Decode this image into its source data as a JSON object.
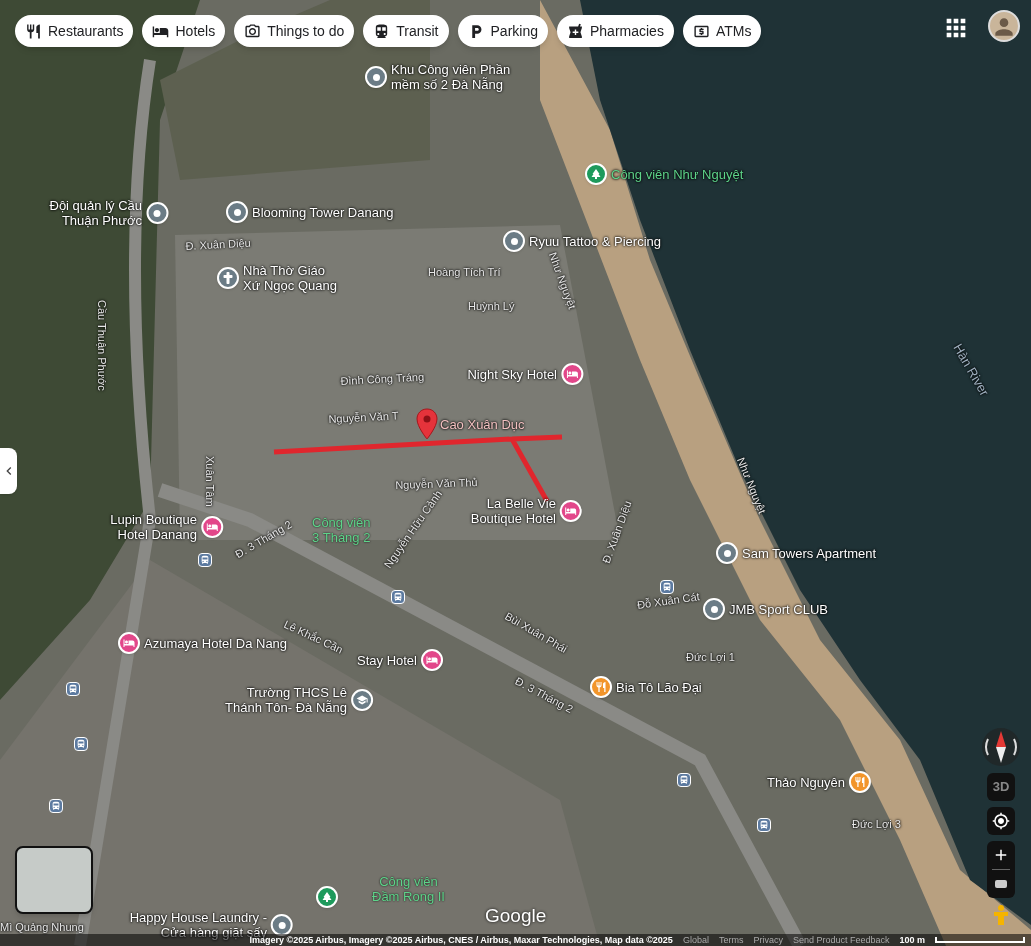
{
  "filter_chips": [
    {
      "label": "Restaurants",
      "kind": "restaurant"
    },
    {
      "label": "Hotels",
      "kind": "hotel"
    },
    {
      "label": "Things to do",
      "kind": "camera"
    },
    {
      "label": "Transit",
      "kind": "transit"
    },
    {
      "label": "Parking",
      "kind": "parking"
    },
    {
      "label": "Pharmacies",
      "kind": "pharmacy"
    },
    {
      "label": "ATMs",
      "kind": "atm"
    }
  ],
  "places": [
    {
      "name": "Khu Công viên Phần\nmềm số 2 Đà Nẵng",
      "kind": "pin",
      "color": "#6b7c86"
    },
    {
      "name": "Công viên Như Nguyệt",
      "kind": "park",
      "color": "#1e9a5c"
    },
    {
      "name": "Đội quản lý Cầu\nThuận Phước",
      "kind": "pin",
      "color": "#6b7c86"
    },
    {
      "name": "Blooming Tower Danang",
      "kind": "pin",
      "color": "#6b7c86"
    },
    {
      "name": "Ryuu Tattoo & Piercing",
      "kind": "pin",
      "color": "#6b7c86"
    },
    {
      "name": "Nhà Thờ Giáo\nXứ Ngọc Quang",
      "kind": "church",
      "color": "#6b7c86"
    },
    {
      "name": "Night Sky Hotel",
      "kind": "hotel",
      "color": "#e2478a"
    },
    {
      "name": "La Belle Vie\nBoutique Hotel",
      "kind": "hotel",
      "color": "#e2478a"
    },
    {
      "name": "Lupin Boutique\nHotel Danang",
      "kind": "hotel",
      "color": "#e2478a"
    },
    {
      "name": "Sam Towers Apartment",
      "kind": "pin",
      "color": "#6b7c86"
    },
    {
      "name": "JMB Sport CLUB",
      "kind": "pin",
      "color": "#6b7c86"
    },
    {
      "name": "Azumaya Hotel Da Nang",
      "kind": "hotel",
      "color": "#e2478a"
    },
    {
      "name": "Stay Hotel",
      "kind": "hotel",
      "color": "#e2478a"
    },
    {
      "name": "Bia Tô Lão Đại",
      "kind": "restaurant",
      "color": "#f2952b"
    },
    {
      "name": "Trường THCS Lê\nThánh Tôn- Đà Nẵng",
      "kind": "school",
      "color": "#6b7c86"
    },
    {
      "name": "Thảo Nguyên",
      "kind": "restaurant",
      "color": "#f2952b"
    },
    {
      "name": "Happy House Laundry -\nCửa hàng giặt sấy",
      "kind": "pin",
      "color": "#6b7c86"
    },
    {
      "kind": "park",
      "color": "#1e9a5c"
    }
  ],
  "park_labels": [
    "Công viên\n3 Tháng 2",
    "Công viên\nĐầm Rong II"
  ],
  "streets": [
    "Đ. Xuân Diệu",
    "Hoàng Tích Trí",
    "Huỳnh Lý",
    "Đình Công Tráng",
    "Nguyễn Văn T",
    "Nguyễn Văn Thủ",
    "Xuân Tâm",
    "Cầu Thuận Phước",
    "Đ. 3 Tháng 2",
    "Đ. 3 Tháng 2",
    "Đỗ Xuân Cát",
    "Đức Lợi 1",
    "Bùi Xuân Phái",
    "Lê Khắc Cần",
    "Như Nguyệt",
    "Như Nguyệt",
    "Đ. Xuân Diệu",
    "Đức Lợi 3",
    "Nguyễn Hữu Cảnh",
    "Mì Quảng Nhung"
  ],
  "river_label": "Hàn River",
  "selected_place": {
    "name": "Cao Xuân Dục"
  },
  "map_logo": "Google",
  "map_controls": {
    "tilt_label": "3D"
  },
  "footer": {
    "attribution": "Imagery ©2025 Airbus, Imagery ©2025 Airbus, CNES / Airbus, Maxar Technologies, Map data ©2025",
    "links": [
      "Global",
      "Terms",
      "Privacy",
      "Send Product Feedback"
    ],
    "scale": "100 m"
  }
}
